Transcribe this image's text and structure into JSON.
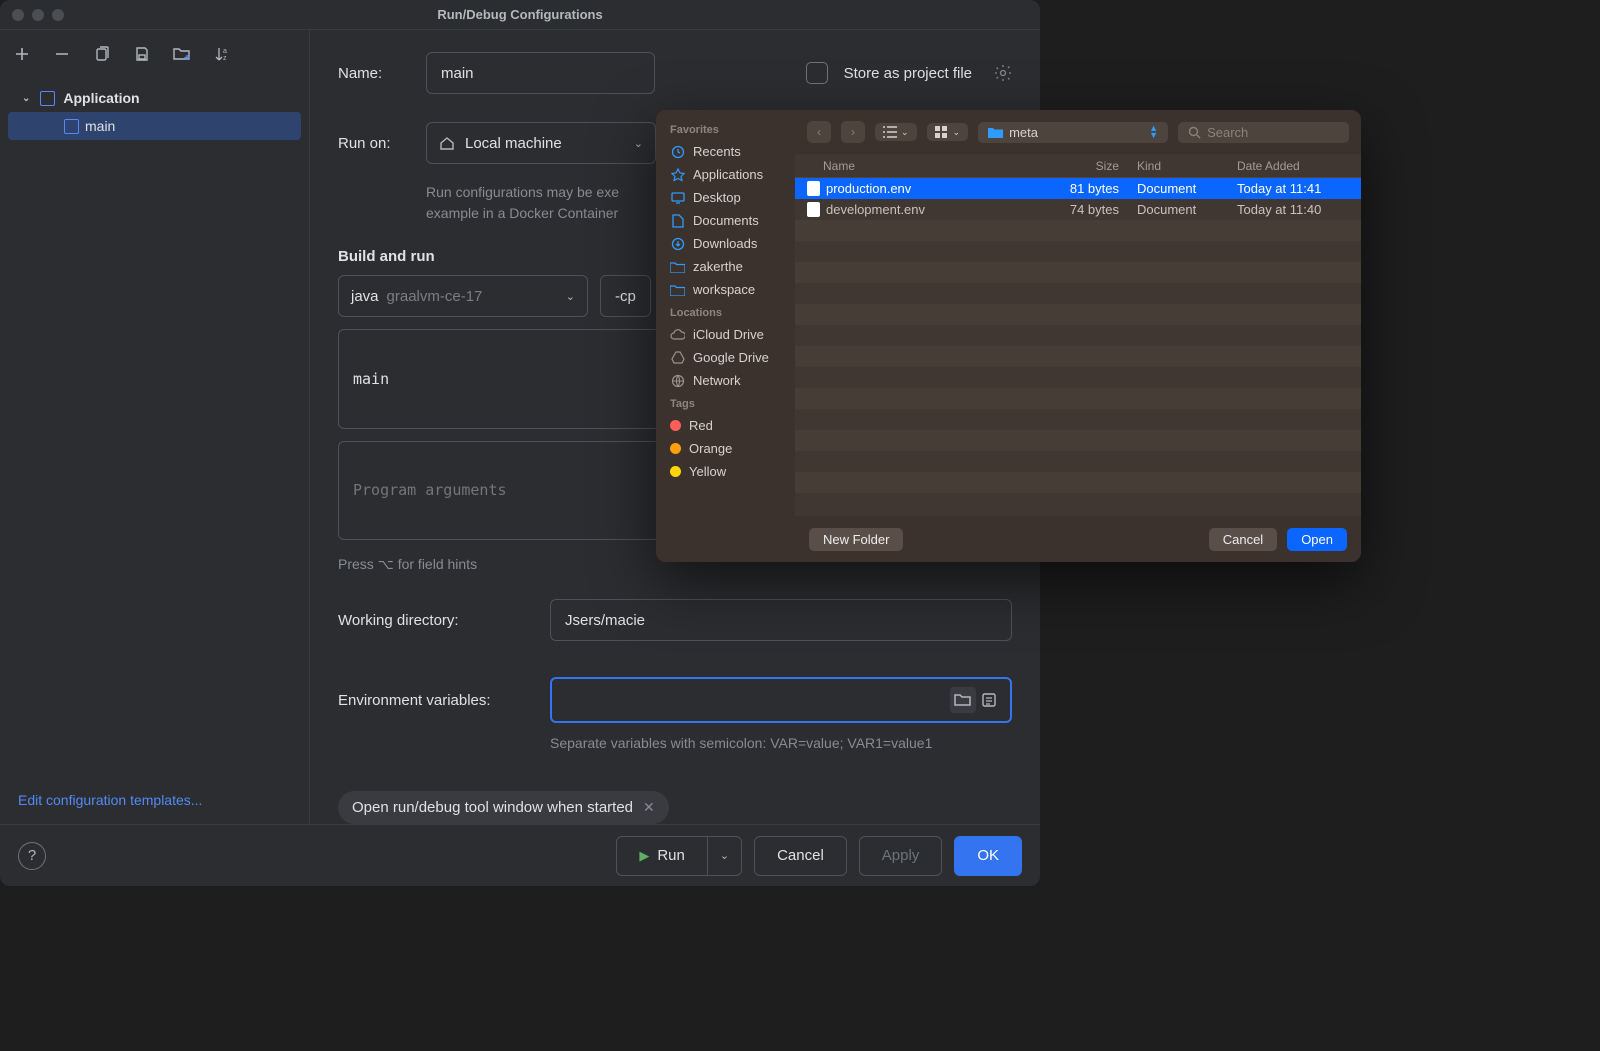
{
  "dialog": {
    "title": "Run/Debug Configurations",
    "tree": {
      "parent": "Application",
      "child": "main"
    },
    "edit_templates": "Edit configuration templates...",
    "name_label": "Name:",
    "name_value": "main",
    "store_label": "Store as project file",
    "run_on_label": "Run on:",
    "run_on_value": "Local machine",
    "run_on_hint1": "Run configurations may be exe",
    "run_on_hint2": "example in a Docker Container",
    "build_section": "Build and run",
    "java_label": "java",
    "java_value": "graalvm-ce-17",
    "cp_value": "-cp",
    "main_class": "main",
    "args_placeholder": "Program arguments",
    "field_hint": "Press ⌥ for field hints",
    "wd_label": "Working directory:",
    "wd_value": "Jsers/macie",
    "env_label": "Environment variables:",
    "env_hint": "Separate variables with semicolon: VAR=value; VAR1=value1",
    "open_tool_chip": "Open run/debug tool window when started",
    "run_btn": "Run",
    "cancel_btn": "Cancel",
    "apply_btn": "Apply",
    "ok_btn": "OK"
  },
  "finder": {
    "sidebar": {
      "favorites_header": "Favorites",
      "favorites": [
        "Recents",
        "Applications",
        "Desktop",
        "Documents",
        "Downloads",
        "zakerthe",
        "workspace"
      ],
      "locations_header": "Locations",
      "locations": [
        "iCloud Drive",
        "Google Drive",
        "Network"
      ],
      "tags_header": "Tags",
      "tags": [
        {
          "name": "Red",
          "color": "#ff5f57"
        },
        {
          "name": "Orange",
          "color": "#ff9f0a"
        },
        {
          "name": "Yellow",
          "color": "#ffd60a"
        }
      ]
    },
    "path": "meta",
    "search_placeholder": "Search",
    "columns": {
      "name": "Name",
      "size": "Size",
      "kind": "Kind",
      "date": "Date Added"
    },
    "rows": [
      {
        "name": "production.env",
        "size": "81 bytes",
        "kind": "Document",
        "date": "Today at 11:41",
        "selected": true
      },
      {
        "name": "development.env",
        "size": "74 bytes",
        "kind": "Document",
        "date": "Today at 11:40",
        "selected": false
      }
    ],
    "new_folder": "New Folder",
    "cancel": "Cancel",
    "open": "Open"
  }
}
